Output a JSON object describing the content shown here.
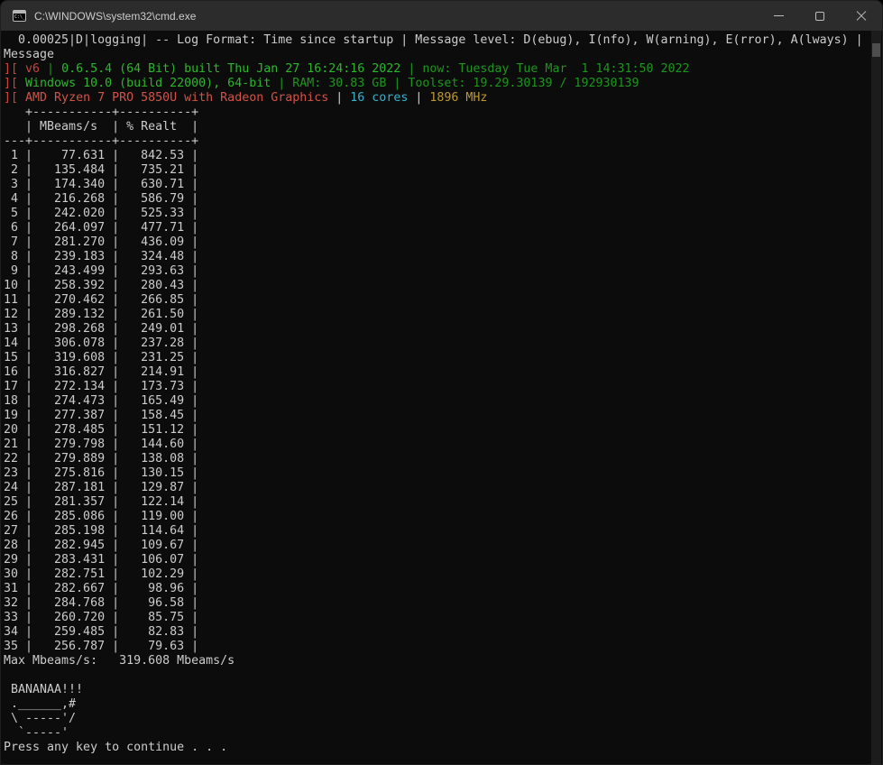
{
  "window": {
    "title": "C:\\WINDOWS\\system32\\cmd.exe"
  },
  "palette": {
    "background": "#0c0c0c",
    "titlebar": "#2c2c2c",
    "default": "#cccccc",
    "red": "#c5453c",
    "red_bright": "#d05348",
    "green": "#2eb52e",
    "green_dark": "#1e941e",
    "cyan": "#3cb0c9",
    "yellow": "#bb9833"
  },
  "log": {
    "line1": "  0.00025|D|logging| -- Log Format: Time since startup | Message level: D(ebug), I(nfo), W(arning), E(rror), A(lways) |",
    "line1_wrap": "Message"
  },
  "system_info": {
    "lines": [
      [
        {
          "text": "][ v6 ",
          "color": "red"
        },
        {
          "text": "| ",
          "color": "green_dark"
        },
        {
          "text": "0.6.5.4 (64 Bit) built Thu Jan 27 16:24:16 2022 ",
          "color": "green"
        },
        {
          "text": "| ",
          "color": "green_dark"
        },
        {
          "text": "now: Tuesday Tue Mar  1 14:31:50 2022",
          "color": "green_dark"
        }
      ],
      [
        {
          "text": "][ ",
          "color": "red"
        },
        {
          "text": "Windows 10.0 (build 22000), 64-bit ",
          "color": "green"
        },
        {
          "text": "| ",
          "color": "green_dark"
        },
        {
          "text": "RAM: 30.83 GB ",
          "color": "green_dark"
        },
        {
          "text": "| ",
          "color": "green_dark"
        },
        {
          "text": "Toolset: 19.29.30139 / 192930139",
          "color": "green_dark"
        }
      ],
      [
        {
          "text": "][ ",
          "color": "red"
        },
        {
          "text": "AMD Ryzen 7 PRO 5850U with Radeon Graphics ",
          "color": "red_bright"
        },
        {
          "text": "| ",
          "color": "default"
        },
        {
          "text": "16 cores ",
          "color": "cyan"
        },
        {
          "text": "| ",
          "color": "default"
        },
        {
          "text": "1896 MHz",
          "color": "yellow"
        }
      ]
    ]
  },
  "table": {
    "headers": [
      "MBeams/s",
      "% Realt"
    ],
    "rows": [
      [
        1,
        77.631,
        842.53
      ],
      [
        2,
        135.484,
        735.21
      ],
      [
        3,
        174.34,
        630.71
      ],
      [
        4,
        216.268,
        586.79
      ],
      [
        5,
        242.02,
        525.33
      ],
      [
        6,
        264.097,
        477.71
      ],
      [
        7,
        281.27,
        436.09
      ],
      [
        8,
        239.183,
        324.48
      ],
      [
        9,
        243.499,
        293.63
      ],
      [
        10,
        258.392,
        280.43
      ],
      [
        11,
        270.462,
        266.85
      ],
      [
        12,
        289.132,
        261.5
      ],
      [
        13,
        298.268,
        249.01
      ],
      [
        14,
        306.078,
        237.28
      ],
      [
        15,
        319.608,
        231.25
      ],
      [
        16,
        316.827,
        214.91
      ],
      [
        17,
        272.134,
        173.73
      ],
      [
        18,
        274.473,
        165.49
      ],
      [
        19,
        277.387,
        158.45
      ],
      [
        20,
        278.485,
        151.12
      ],
      [
        21,
        279.798,
        144.6
      ],
      [
        22,
        279.889,
        138.08
      ],
      [
        23,
        275.816,
        130.15
      ],
      [
        24,
        287.181,
        129.87
      ],
      [
        25,
        281.357,
        122.14
      ],
      [
        26,
        285.086,
        119.0
      ],
      [
        27,
        285.198,
        114.64
      ],
      [
        28,
        282.945,
        109.67
      ],
      [
        29,
        283.431,
        106.07
      ],
      [
        30,
        282.751,
        102.29
      ],
      [
        31,
        282.667,
        98.96
      ],
      [
        32,
        284.768,
        96.58
      ],
      [
        33,
        260.72,
        85.75
      ],
      [
        34,
        259.485,
        82.83
      ],
      [
        35,
        256.787,
        79.63
      ]
    ]
  },
  "summary": {
    "label": "Max Mbeams/s:",
    "value": 319.608,
    "unit": "Mbeams/s"
  },
  "banana": {
    "title": "BANANAA!!!",
    "art": [
      " .______,#",
      " \\ -----'/",
      "  `-----'"
    ]
  },
  "prompt": "Press any key to continue . . ."
}
